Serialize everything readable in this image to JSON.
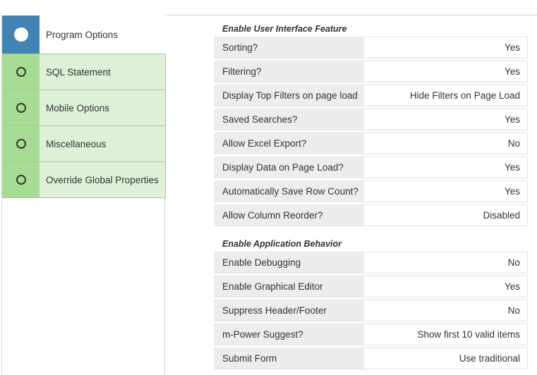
{
  "sidebar": {
    "items": [
      {
        "label": "Program Options",
        "active": true
      },
      {
        "label": "SQL Statement",
        "active": false
      },
      {
        "label": "Mobile Options",
        "active": false
      },
      {
        "label": "Miscellaneous",
        "active": false
      },
      {
        "label": "Override Global Properties",
        "active": false
      }
    ]
  },
  "sections": [
    {
      "title": "Enable User Interface Feature",
      "rows": [
        {
          "label": "Sorting?",
          "value": "Yes"
        },
        {
          "label": "Filtering?",
          "value": "Yes"
        },
        {
          "label": "Display Top Filters on page load",
          "value": "Hide Filters on Page Load"
        },
        {
          "label": "Saved Searches?",
          "value": "Yes"
        },
        {
          "label": "Allow Excel Export?",
          "value": "No"
        },
        {
          "label": "Display Data on Page Load?",
          "value": "Yes"
        },
        {
          "label": "Automatically Save Row Count?",
          "value": "Yes"
        },
        {
          "label": "Allow Column Reorder?",
          "value": "Disabled"
        }
      ]
    },
    {
      "title": "Enable Application Behavior",
      "rows": [
        {
          "label": "Enable Debugging",
          "value": "No"
        },
        {
          "label": "Enable Graphical Editor",
          "value": "Yes"
        },
        {
          "label": "Suppress Header/Footer",
          "value": "No"
        },
        {
          "label": "m-Power Suggest?",
          "value": "Show first 10 valid items"
        },
        {
          "label": "Submit Form",
          "value": "Use traditional"
        }
      ]
    }
  ],
  "colors": {
    "active_tab": "#3f84b4",
    "inactive_icon_bg": "#a8dc94",
    "inactive_tab_bg": "#dff0d8",
    "label_cell_bg": "#ededed"
  }
}
